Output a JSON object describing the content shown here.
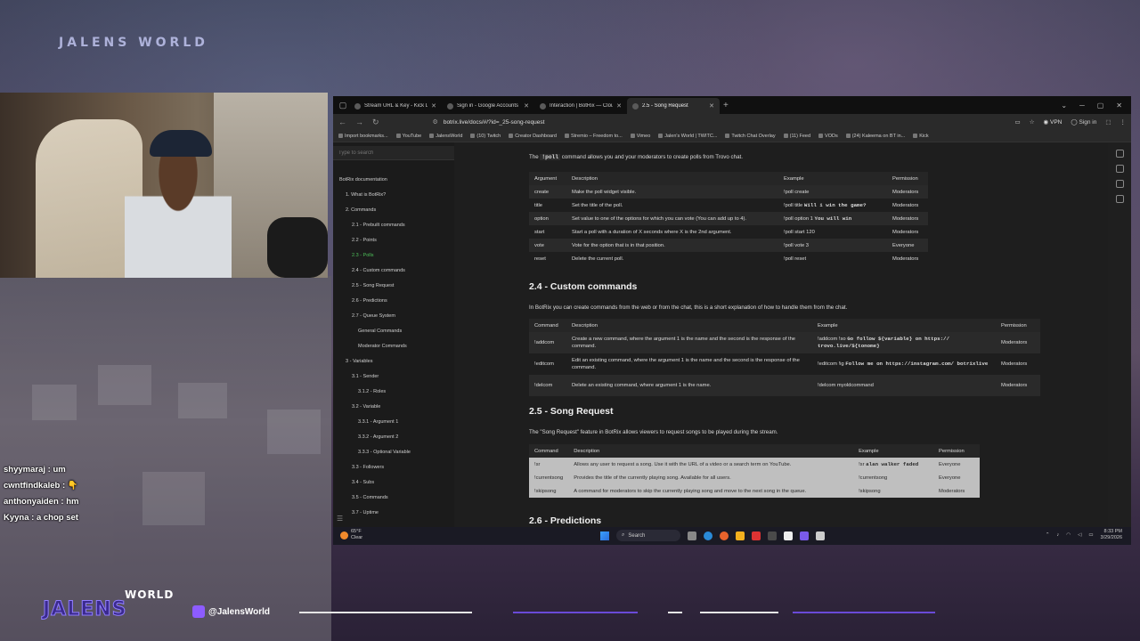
{
  "overlay": {
    "brand_top": "JALENS WORLD",
    "chat": [
      {
        "user": "shyymaraj",
        "message": "um"
      },
      {
        "user": "cwntfindkaleb",
        "message": "👇"
      },
      {
        "user": "anthonyaiden",
        "message": "hm"
      },
      {
        "user": "Kyyna",
        "message": "a chop set"
      }
    ],
    "logo_world": "WORLD",
    "logo_jalens": "JALENS",
    "social_handle": "@JalensWorld"
  },
  "browser": {
    "tabs": [
      {
        "label": "Stream URL & Key - Kick Dashb",
        "active": false
      },
      {
        "label": "Sign in - Google Accounts",
        "active": false
      },
      {
        "label": "Interaction | BotRix — Cloud St",
        "active": false
      },
      {
        "label": "2.5 - Song Request",
        "active": true
      }
    ],
    "new_tab": "+",
    "url": "botrix.live/docs/#/?id=_25-song-request",
    "vpn_label": "VPN",
    "sign_in": "Sign in",
    "bookmarks": [
      "Import bookmarks...",
      "YouTube",
      "JalensWorld",
      "(10) Twitch",
      "Creator Dashboard",
      "Stremio – Freedom to...",
      "Vimeo",
      "Jalen's World | TWITC...",
      "Twitch Chat Overlay",
      "(11) Feed",
      "VODs",
      "(24) Kaleema on BT in...",
      "Kick"
    ]
  },
  "sidebar": {
    "search_placeholder": "Type to search",
    "items": [
      {
        "label": "BotRix documentation",
        "level": 0,
        "active": false
      },
      {
        "label": "1. What is BotRix?",
        "level": 1,
        "active": false
      },
      {
        "label": "2. Commands",
        "level": 1,
        "active": false
      },
      {
        "label": "2.1 - Prebuilt commands",
        "level": 2,
        "active": false
      },
      {
        "label": "2.2 - Points",
        "level": 2,
        "active": false
      },
      {
        "label": "2.3 - Polls",
        "level": 2,
        "active": true
      },
      {
        "label": "2.4 - Custom commands",
        "level": 2,
        "active": false
      },
      {
        "label": "2.5 - Song Request",
        "level": 2,
        "active": false
      },
      {
        "label": "2.6 - Predictions",
        "level": 2,
        "active": false
      },
      {
        "label": "2.7 - Queue System",
        "level": 2,
        "active": false
      },
      {
        "label": "General Commands",
        "level": 3,
        "active": false
      },
      {
        "label": "Moderator Commands",
        "level": 3,
        "active": false
      },
      {
        "label": "3 - Variables",
        "level": 1,
        "active": false
      },
      {
        "label": "3.1 - Sender",
        "level": 2,
        "active": false
      },
      {
        "label": "3.1.2 - Roles",
        "level": 3,
        "active": false
      },
      {
        "label": "3.2 - Variable",
        "level": 2,
        "active": false
      },
      {
        "label": "3.3.1 - Argument 1",
        "level": 3,
        "active": false
      },
      {
        "label": "3.3.2 - Argument 2",
        "level": 3,
        "active": false
      },
      {
        "label": "3.3.3 - Optional Variable",
        "level": 3,
        "active": false
      },
      {
        "label": "3.3 - Followers",
        "level": 2,
        "active": false
      },
      {
        "label": "3.4 - Subs",
        "level": 2,
        "active": false
      },
      {
        "label": "3.5 - Commands",
        "level": 2,
        "active": false
      },
      {
        "label": "3.7 - Uptime",
        "level": 2,
        "active": false
      }
    ]
  },
  "main": {
    "poll_intro_prefix": "The",
    "poll_intro_code": "!poll",
    "poll_intro_suffix": "command allows you and your moderators to create polls from Trovo chat.",
    "poll_table": {
      "headers": [
        "Argument",
        "Description",
        "Example",
        "Permission"
      ],
      "rows": [
        {
          "arg": "create",
          "desc": "Make the poll widget visible.",
          "ex": "!poll create",
          "ex_code": "",
          "perm": "Moderators"
        },
        {
          "arg": "title",
          "desc": "Set the title of the poll.",
          "ex": "!poll title",
          "ex_code": "Will i win the game?",
          "perm": "Moderators"
        },
        {
          "arg": "option",
          "desc": "Set value to one of the options for which you can vote (You can add up to 4).",
          "ex": "!poll option 1",
          "ex_code": "You will win",
          "perm": "Moderators"
        },
        {
          "arg": "start",
          "desc": "Start a poll with a duration of X seconds where X is the 2nd argument.",
          "ex": "!poll start 120",
          "ex_code": "",
          "perm": "Moderators"
        },
        {
          "arg": "vote",
          "desc": "Vote for the option that is in that position.",
          "ex": "!poll vote 3",
          "ex_code": "",
          "perm": "Everyone"
        },
        {
          "arg": "reset",
          "desc": "Delete the current poll.",
          "ex": "!poll reset",
          "ex_code": "",
          "perm": "Moderators"
        }
      ]
    },
    "custom_heading": "2.4 - Custom commands",
    "custom_intro": "In BotRix you can create commands from the web or from the chat, this is a short explanation of how to handle them from the chat.",
    "custom_table": {
      "headers": [
        "Command",
        "Description",
        "Example",
        "Permission"
      ],
      "rows": [
        {
          "cmd": "!addcom",
          "desc": "Create a new command, where the argument 1 is the name and the second is the response of the command.",
          "ex": "!addcom !so",
          "ex_code": "Go follow ${variable} on https:// trovo.live/${tonome}",
          "perm": "Moderators"
        },
        {
          "cmd": "!editcom",
          "desc": "Edit an existing command, where the argument 1 is the name and the second is the response of the command.",
          "ex": "!editcom !ig",
          "ex_code": "Follow me on https://instagram.com/ botrixlive",
          "perm": "Moderators"
        },
        {
          "cmd": "!delcom",
          "desc": "Delete an existing command, where argument 1 is the name.",
          "ex": "!delcom myoldcommand",
          "ex_code": "",
          "perm": "Moderators"
        }
      ]
    },
    "song_heading": "2.5 - Song Request",
    "song_intro": "The \"Song Request\" feature in BotRix allows viewers to request songs to be played during the stream.",
    "song_table": {
      "headers": [
        "Command",
        "Description",
        "Example",
        "Permission"
      ],
      "rows": [
        {
          "cmd": "!sr",
          "desc": "Allows any user to request a song. Use it with the URL of a video or a search term on YouTube.",
          "ex": "!sr",
          "ex_code": "alan walker faded",
          "perm": "Everyone"
        },
        {
          "cmd": "!currentsong",
          "desc": "Provides the title of the currently playing song. Available for all users.",
          "ex": "!currentsong",
          "ex_code": "",
          "perm": "Everyone"
        },
        {
          "cmd": "!skipsong",
          "desc": "A command for moderators to skip the currently playing song and move to the next song in the queue.",
          "ex": "!skipsong",
          "ex_code": "",
          "perm": "Moderators"
        }
      ]
    },
    "predictions_heading": "2.6 - Predictions"
  },
  "taskbar": {
    "weather_temp": "65°F",
    "weather_desc": "Clear",
    "search_label": "Search",
    "time": "8:33 PM",
    "date": "3/29/2026"
  }
}
